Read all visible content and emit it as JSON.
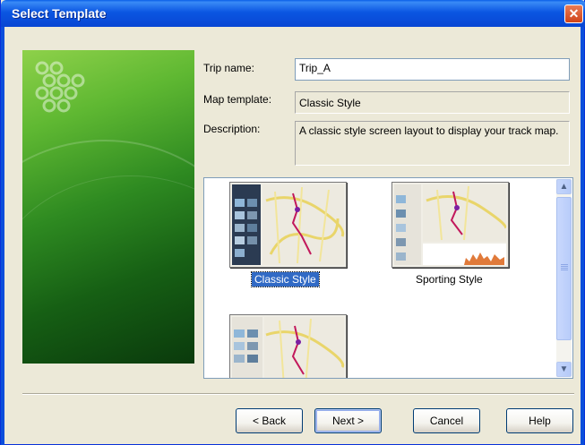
{
  "window": {
    "title": "Select Template",
    "close_glyph": "✕"
  },
  "form": {
    "trip_name_label": "Trip name:",
    "trip_name_value": "Trip_A",
    "map_template_label": "Map template:",
    "map_template_value": "Classic Style",
    "description_label": "Description:",
    "description_value": "A classic style screen layout to display your track map."
  },
  "gallery": {
    "templates": [
      {
        "label": "Classic Style",
        "selected": true
      },
      {
        "label": "Sporting Style",
        "selected": false
      },
      {
        "label": "",
        "selected": false
      }
    ],
    "scroll_up": "▲",
    "scroll_down": "▼"
  },
  "buttons": {
    "back": "< Back",
    "next": "Next >",
    "cancel": "Cancel",
    "help": "Help"
  },
  "colors": {
    "accent": "#316AC5",
    "titlebar": "#0A5FE8",
    "banner_green": "#2E8A21"
  },
  "icons": {
    "logo": "dot-cluster-logo",
    "close": "close-icon"
  }
}
